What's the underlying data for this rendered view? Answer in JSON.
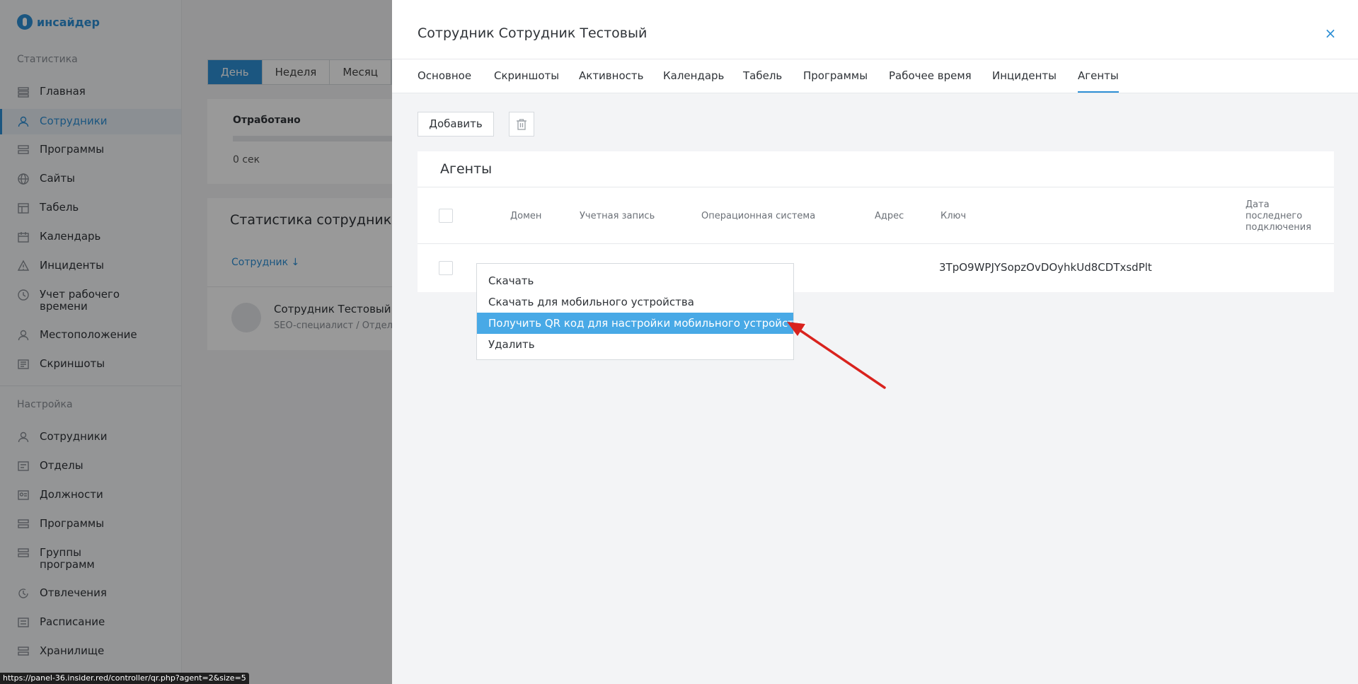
{
  "app": {
    "logo_text": "инсайдер"
  },
  "sidebar": {
    "section_stats": "Статистика",
    "section_settings": "Настройка",
    "stats_items": [
      {
        "label": "Главная",
        "icon": "grid-icon"
      },
      {
        "label": "Сотрудники",
        "icon": "user-icon",
        "active": true
      },
      {
        "label": "Программы",
        "icon": "stack-icon"
      },
      {
        "label": "Сайты",
        "icon": "globe-icon"
      },
      {
        "label": "Табель",
        "icon": "table-icon"
      },
      {
        "label": "Календарь",
        "icon": "calendar-icon"
      },
      {
        "label": "Инциденты",
        "icon": "alert-icon"
      },
      {
        "label": "Учет рабочего времени",
        "icon": "clock-icon"
      },
      {
        "label": "Местоположение",
        "icon": "location-icon"
      },
      {
        "label": "Скриншоты",
        "icon": "image-icon"
      }
    ],
    "settings_items": [
      {
        "label": "Сотрудники",
        "icon": "user-icon"
      },
      {
        "label": "Отделы",
        "icon": "folder-icon"
      },
      {
        "label": "Должности",
        "icon": "badge-icon"
      },
      {
        "label": "Программы",
        "icon": "stack-icon"
      },
      {
        "label": "Группы программ",
        "icon": "group-icon"
      },
      {
        "label": "Отвлечения",
        "icon": "distraction-icon"
      },
      {
        "label": "Расписание",
        "icon": "schedule-icon"
      },
      {
        "label": "Хранилище",
        "icon": "storage-icon"
      }
    ]
  },
  "background": {
    "period_tabs": [
      "День",
      "Неделя",
      "Месяц"
    ],
    "worked_title": "Отработано",
    "worked_value": "0 сек",
    "stats_title": "Статистика сотрудников",
    "sort_label": "Сотрудник ↓",
    "employee_name": "Сотрудник Тестовый",
    "employee_position": "SEO-специалист / Отдел"
  },
  "modal": {
    "title": "Сотрудник Сотрудник Тестовый",
    "close_icon": "close-icon",
    "tabs": [
      "Основное",
      "Скриншоты",
      "Активность",
      "Календарь",
      "Табель",
      "Программы",
      "Рабочее время",
      "Инциденты",
      "Агенты"
    ],
    "active_tab": "Агенты",
    "add_button": "Добавить",
    "delete_icon": "trash-icon",
    "agents_card": {
      "title": "Агенты",
      "columns": [
        "Домен",
        "Учетная запись",
        "Операционная система",
        "Адрес",
        "Ключ",
        "Дата последнего подключения"
      ],
      "row": {
        "key": "3TpO9WPJYSopzOvDOyhkUd8CDTxsdPlt"
      }
    },
    "context_menu": [
      "Скачать",
      "Скачать для мобильного устройства",
      "Получить QR код для настройки мобильного устройства",
      "Удалить"
    ],
    "highlighted_menu_item": "Получить QR код для настройки мобильного устройства"
  },
  "status_bar": {
    "url": "https://panel-36.insider.red/controller/qr.php?agent=2&size=5"
  },
  "colors": {
    "accent": "#2d8fd5",
    "menu_highlight": "#48a9e6",
    "annotation_arrow": "#d9231e"
  }
}
